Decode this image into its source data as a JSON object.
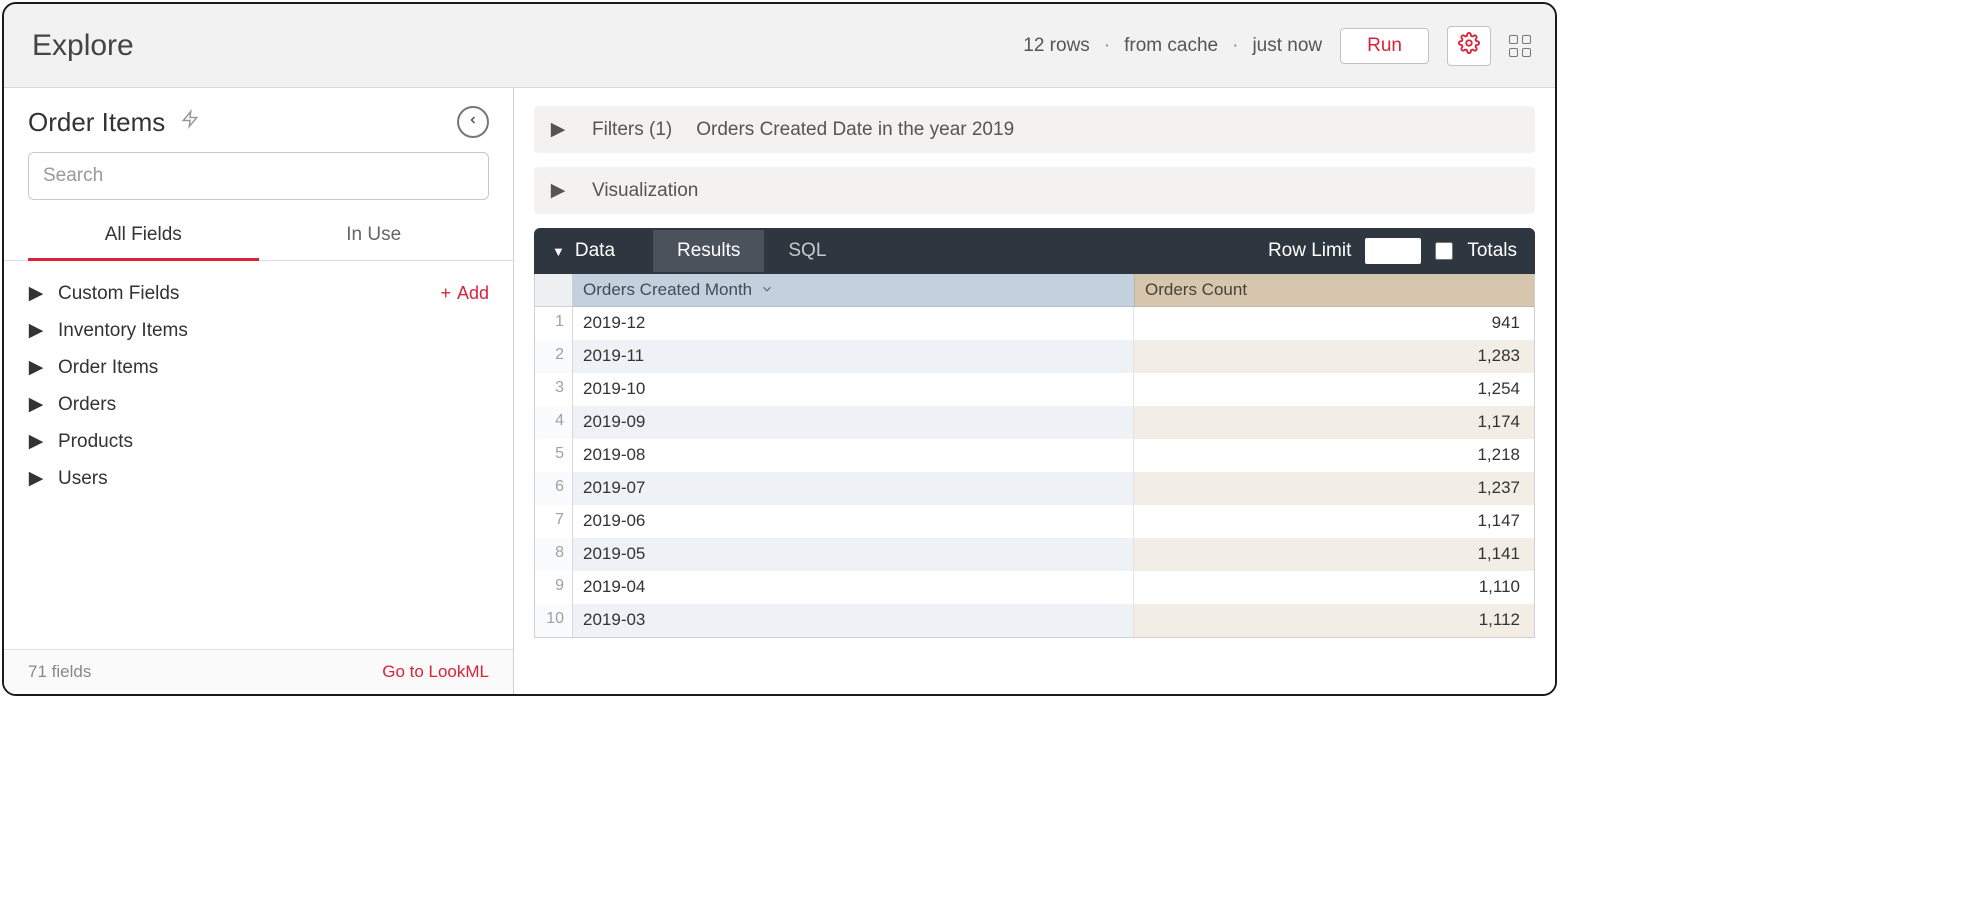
{
  "header": {
    "title": "Explore",
    "meta_rows": "12 rows",
    "meta_cache": "from cache",
    "meta_time": "just now",
    "run_label": "Run"
  },
  "sidebar": {
    "title": "Order Items",
    "search_placeholder": "Search",
    "tabs": {
      "all": "All Fields",
      "inuse": "In Use"
    },
    "add_label": "Add",
    "groups": [
      "Custom Fields",
      "Inventory Items",
      "Order Items",
      "Orders",
      "Products",
      "Users"
    ],
    "footer_fields": "71 fields",
    "footer_lookml": "Go to LookML"
  },
  "main": {
    "filters_label": "Filters (1)",
    "filters_desc": "Orders Created Date in the year 2019",
    "visualization_label": "Visualization",
    "databar": {
      "data_label": "Data",
      "results_label": "Results",
      "sql_label": "SQL",
      "rowlimit_label": "Row Limit",
      "totals_label": "Totals"
    },
    "columns": {
      "dim": "Orders Created Month",
      "meas": "Orders Count"
    },
    "rows": [
      {
        "n": "1",
        "month": "2019-12",
        "count": "941"
      },
      {
        "n": "2",
        "month": "2019-11",
        "count": "1,283"
      },
      {
        "n": "3",
        "month": "2019-10",
        "count": "1,254"
      },
      {
        "n": "4",
        "month": "2019-09",
        "count": "1,174"
      },
      {
        "n": "5",
        "month": "2019-08",
        "count": "1,218"
      },
      {
        "n": "6",
        "month": "2019-07",
        "count": "1,237"
      },
      {
        "n": "7",
        "month": "2019-06",
        "count": "1,147"
      },
      {
        "n": "8",
        "month": "2019-05",
        "count": "1,141"
      },
      {
        "n": "9",
        "month": "2019-04",
        "count": "1,110"
      },
      {
        "n": "10",
        "month": "2019-03",
        "count": "1,112"
      }
    ]
  }
}
